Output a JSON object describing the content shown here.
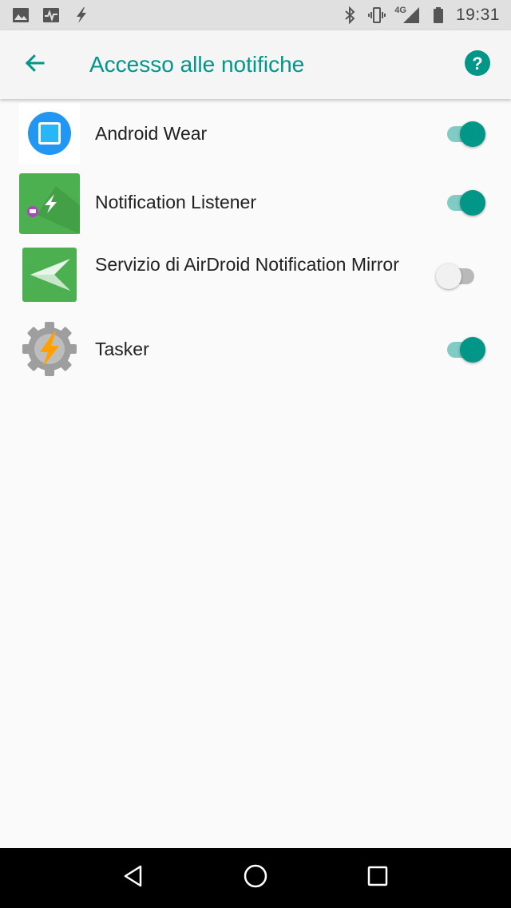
{
  "status_bar": {
    "time": "19:31",
    "network": "4G",
    "left_icons": [
      "image-icon",
      "pulse-icon",
      "flash-icon"
    ],
    "right_icons": [
      "bluetooth-icon",
      "vibrate-icon",
      "signal-icon",
      "battery-icon"
    ]
  },
  "app_bar": {
    "title": "Accesso alle notifiche",
    "accent_color": "#009688"
  },
  "apps": [
    {
      "name": "Android Wear",
      "icon": "android-wear-icon",
      "enabled": true
    },
    {
      "name": "Notification Listener",
      "icon": "notification-listener-icon",
      "enabled": true
    },
    {
      "name": "Servizio di AirDroid Notification Mirror",
      "icon": "airdroid-icon",
      "enabled": false
    },
    {
      "name": "Tasker",
      "icon": "tasker-icon",
      "enabled": true
    }
  ],
  "nav_bar": {
    "buttons": [
      "back-triangle-icon",
      "home-circle-icon",
      "recents-square-icon"
    ]
  }
}
